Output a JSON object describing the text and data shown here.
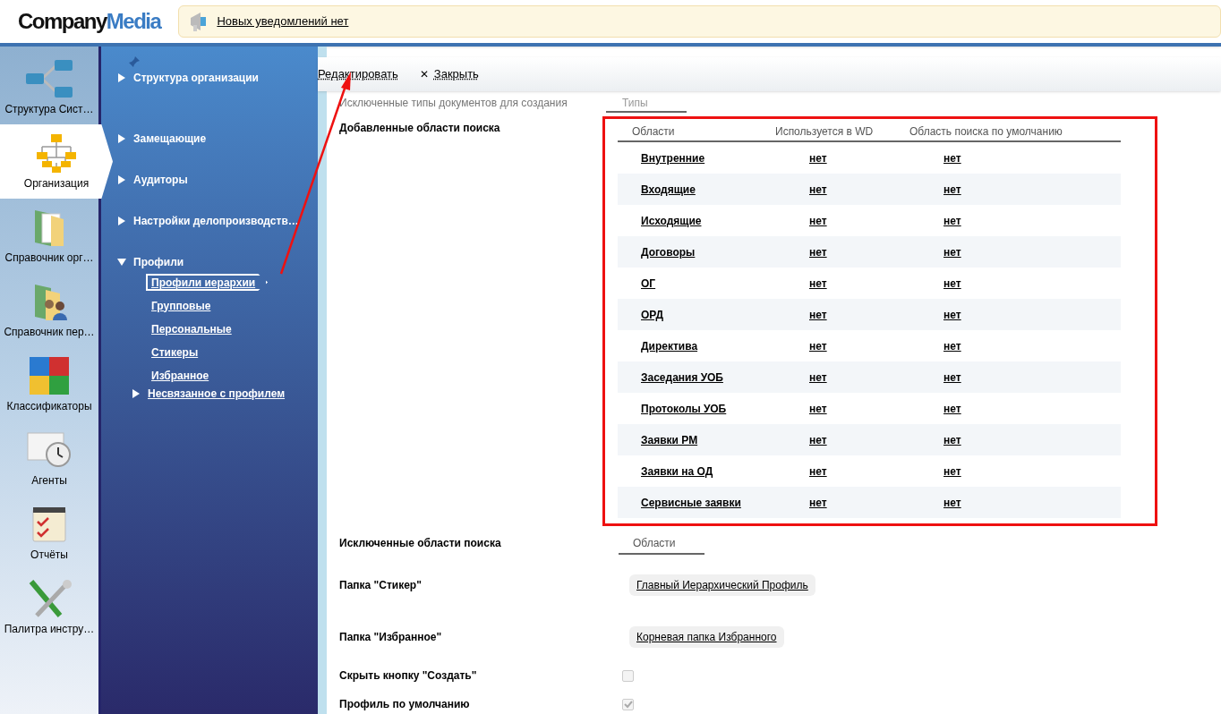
{
  "header": {
    "logo": {
      "part1": "Company",
      "part2": "Media"
    },
    "notification": "Новых уведомлений нет"
  },
  "modules": [
    {
      "label": "Структура Сист…",
      "selected": false
    },
    {
      "label": "Организация",
      "selected": true
    },
    {
      "label": "Справочник орг…",
      "selected": false
    },
    {
      "label": "Справочник пер…",
      "selected": false
    },
    {
      "label": "Классификаторы",
      "selected": false
    },
    {
      "label": "Агенты",
      "selected": false
    },
    {
      "label": "Отчёты",
      "selected": false
    },
    {
      "label": "Палитра инстру…",
      "selected": false
    }
  ],
  "nav": [
    {
      "label": "Структура организации",
      "expanded": false
    },
    {
      "label": "Замещающие",
      "expanded": false
    },
    {
      "label": "Аудиторы",
      "expanded": false
    },
    {
      "label": "Настройки делопроизводств…",
      "expanded": false
    },
    {
      "label": "Профили",
      "expanded": true,
      "children": [
        {
          "label": "Профили иерархии",
          "selected": true
        },
        {
          "label": "Групповые",
          "selected": false
        },
        {
          "label": "Персональные",
          "selected": false
        },
        {
          "label": "Стикеры",
          "selected": false
        },
        {
          "label": "Избранное",
          "selected": false
        }
      ]
    },
    {
      "label": "Несвязанное с профилем",
      "expanded": false,
      "kind": "link"
    }
  ],
  "toolbar": {
    "edit": "Редактировать",
    "close_icon": "✕",
    "close": "Закрыть"
  },
  "form": {
    "excluded_types": {
      "label": "Исключенные типы документов для создания",
      "column": "Типы"
    },
    "added_areas": {
      "label": "Добавленные области поиска",
      "columns": [
        "Области",
        "Используется в WD",
        "Область поиска по умолчанию"
      ],
      "rows": [
        [
          "Внутренние",
          "нет",
          "нет"
        ],
        [
          "Входящие",
          "нет",
          "нет"
        ],
        [
          "Исходящие",
          "нет",
          "нет"
        ],
        [
          "Договоры",
          "нет",
          "нет"
        ],
        [
          "ОГ",
          "нет",
          "нет"
        ],
        [
          "ОРД",
          "нет",
          "нет"
        ],
        [
          "Директива",
          "нет",
          "нет"
        ],
        [
          "Заседания УОБ",
          "нет",
          "нет"
        ],
        [
          "Протоколы УОБ",
          "нет",
          "нет"
        ],
        [
          "Заявки РМ",
          "нет",
          "нет"
        ],
        [
          "Заявки на ОД",
          "нет",
          "нет"
        ],
        [
          "Сервисные заявки",
          "нет",
          "нет"
        ]
      ]
    },
    "excluded_areas": {
      "label": "Исключенные области поиска",
      "column": "Области"
    },
    "sticker_folder": {
      "label": "Папка \"Стикер\"",
      "value": "Главный Иерархический Профиль"
    },
    "favorites_folder": {
      "label": "Папка \"Избранное\"",
      "value": "Корневая папка Избранного"
    },
    "hide_create": {
      "label": "Скрыть кнопку \"Создать\"",
      "checked": false
    },
    "default_profile": {
      "label": "Профиль по умолчанию",
      "checked": true
    }
  }
}
